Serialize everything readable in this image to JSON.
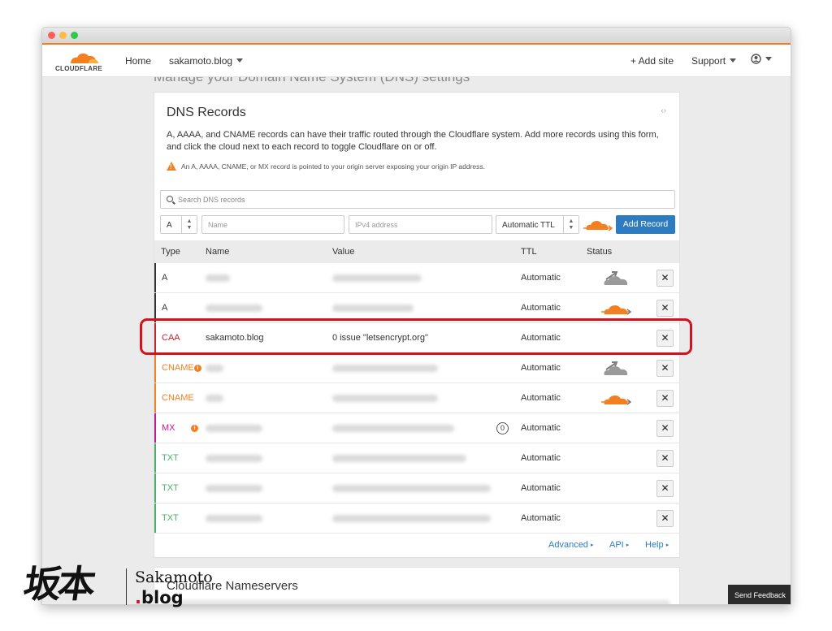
{
  "colors": {
    "accent_orange": "#f38020",
    "primary_blue": "#2f7bbf",
    "highlight_red": "#d2121e",
    "caa": "#c3232b",
    "cname": "#f38020",
    "mx": "#c21a8c",
    "txt": "#4caf6a"
  },
  "nav": {
    "logo": "CLOUDFLARE",
    "home": "Home",
    "site": "sakamoto.blog",
    "add_site": "+ Add site",
    "support": "Support"
  },
  "page": {
    "heading_partial": "Manage your Domain Name System (DNS) settings"
  },
  "dns": {
    "title": "DNS Records",
    "description": "A, AAAA, and CNAME records can have their traffic routed through the Cloudflare system. Add more records using this form, and click the cloud next to each record to toggle Cloudflare on or off.",
    "warning": "An A, AAAA, CNAME, or MX record is pointed to your origin server exposing your origin IP address.",
    "search_placeholder": "Search DNS records",
    "form": {
      "type_value": "A",
      "name_placeholder": "Name",
      "value_placeholder": "IPv4 address",
      "ttl_value": "Automatic TTL",
      "add_button": "Add Record"
    },
    "columns": {
      "type": "Type",
      "name": "Name",
      "value": "Value",
      "ttl": "TTL",
      "status": "Status"
    },
    "rows": [
      {
        "type": "A",
        "name": "",
        "value": "",
        "ttl": "Automatic",
        "status_icon": "cloud-dns-only-icon"
      },
      {
        "type": "A",
        "name": "",
        "value": "",
        "ttl": "Automatic",
        "status_icon": "cloud-proxied-icon"
      },
      {
        "type": "CAA",
        "name": "sakamoto.blog",
        "value": "0 issue \"letsencrypt.org\"",
        "ttl": "Automatic",
        "status_icon": ""
      },
      {
        "type": "CNAME",
        "name": "",
        "value": "",
        "ttl": "Automatic",
        "status_icon": "cloud-dns-only-icon"
      },
      {
        "type": "CNAME",
        "name": "",
        "value": "",
        "ttl": "Automatic",
        "status_icon": "cloud-proxied-icon"
      },
      {
        "type": "MX",
        "name": "",
        "value": "",
        "priority": "0",
        "ttl": "Automatic",
        "status_icon": ""
      },
      {
        "type": "TXT",
        "name": "",
        "value": "",
        "ttl": "Automatic",
        "status_icon": ""
      },
      {
        "type": "TXT",
        "name": "",
        "value": "",
        "ttl": "Automatic",
        "status_icon": ""
      },
      {
        "type": "TXT",
        "name": "",
        "value": "",
        "ttl": "Automatic",
        "status_icon": ""
      }
    ],
    "delete_label": "✕",
    "links": {
      "advanced": "Advanced",
      "api": "API",
      "help": "Help"
    }
  },
  "nameservers": {
    "title": "Cloudflare Nameservers"
  },
  "feedback": "Send Feedback",
  "watermark": {
    "chars": "坂本",
    "name": "Sakamoto",
    "blog": "blog"
  }
}
